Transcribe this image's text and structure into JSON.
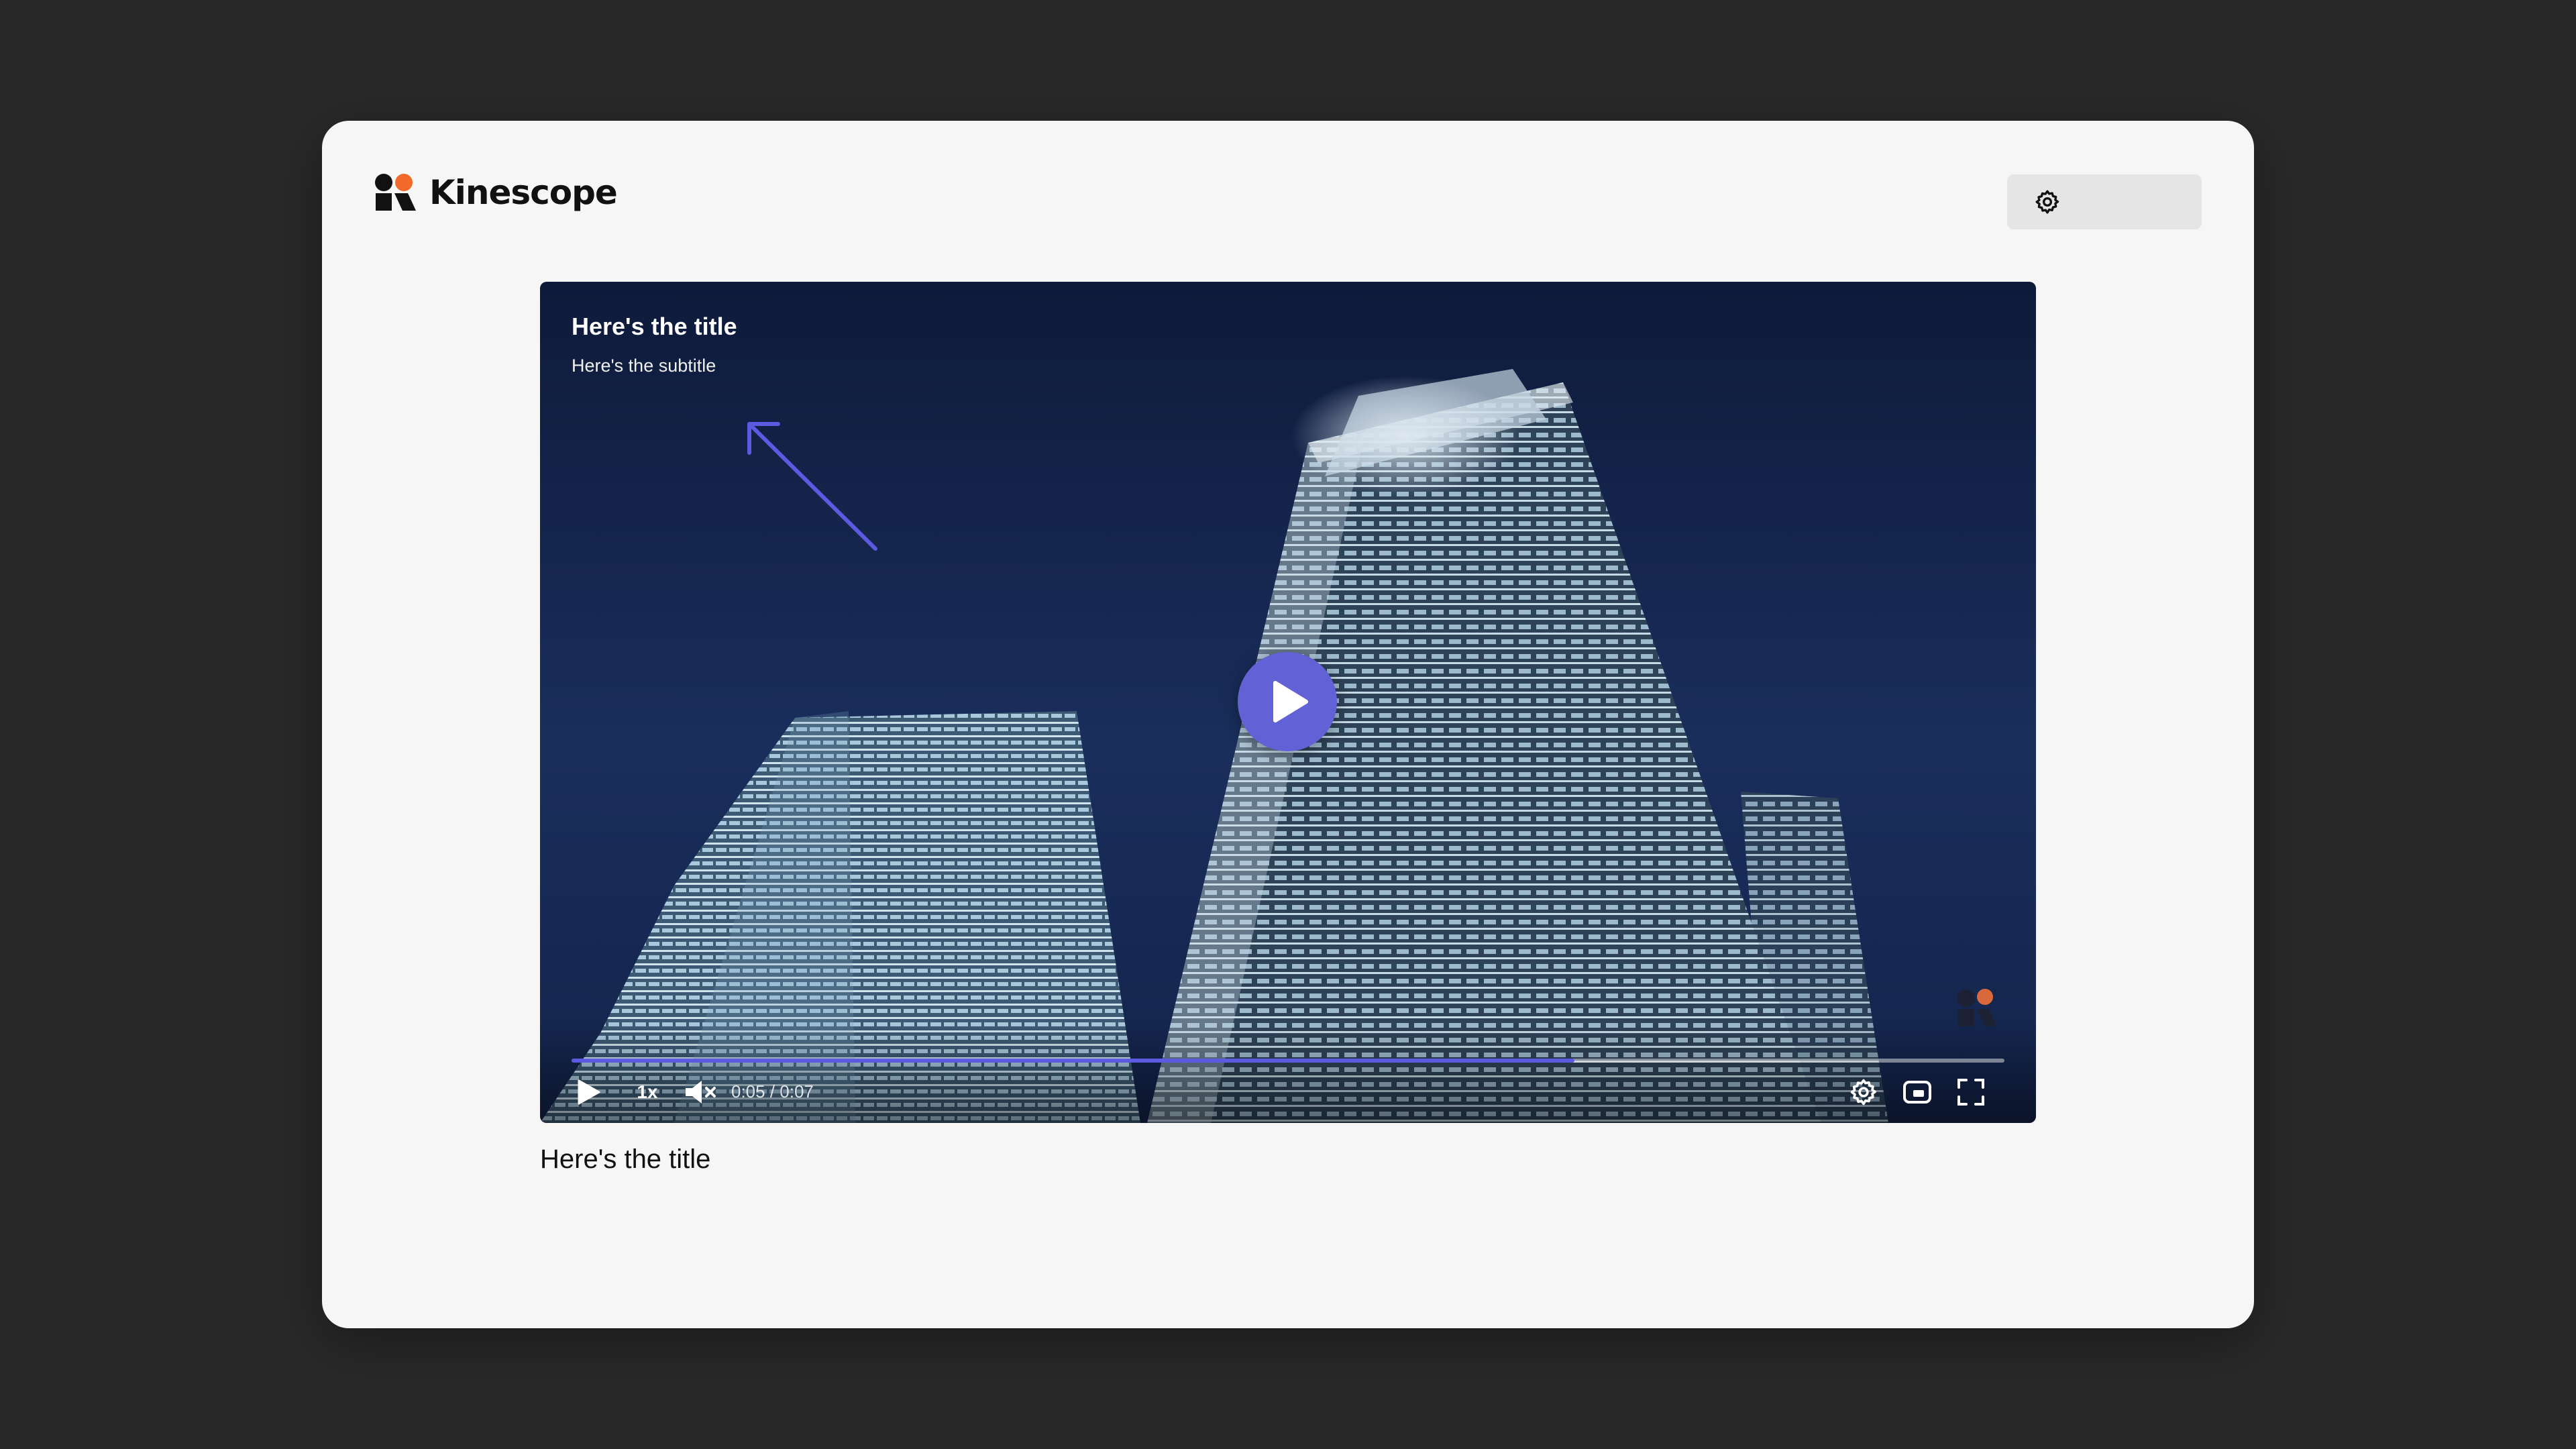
{
  "brand": {
    "name": "Kinescope",
    "accent": "#f26b2b",
    "mark_color": "#111111"
  },
  "toolbar": {
    "settings_icon": "gear-icon"
  },
  "player": {
    "overlay_title": "Here's the title",
    "overlay_subtitle": "Here's the subtitle",
    "accent": "#5b5ae0",
    "progress_fraction": 0.7,
    "speed_label": "1x",
    "time_label": "0:05 / 0:07",
    "icons": {
      "play": "play-icon",
      "mute": "volume-muted-icon",
      "settings": "gear-icon",
      "pip": "picture-in-picture-icon",
      "fullscreen": "fullscreen-icon"
    }
  },
  "video": {
    "title": "Here's the title"
  }
}
